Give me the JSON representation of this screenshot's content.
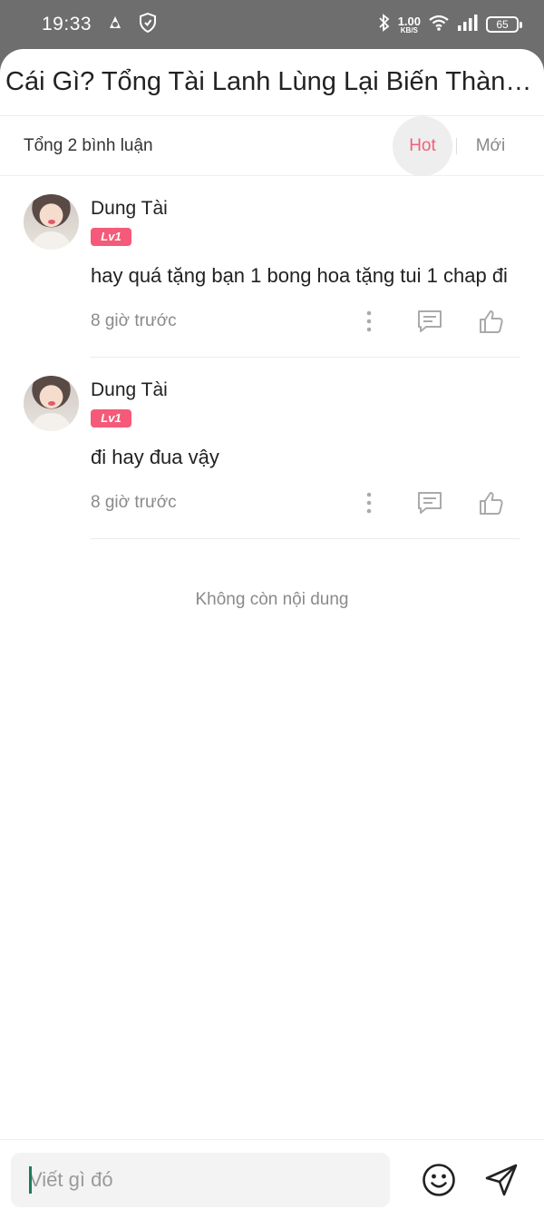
{
  "status": {
    "time": "19:33",
    "net_speed_value": "1.00",
    "net_speed_unit": "KB/S",
    "battery": "65"
  },
  "header": {
    "title": "Cái Gì? Tổng Tài Lanh Lùng Lại Biến Thành ..."
  },
  "filter": {
    "total": "Tổng 2 bình luận",
    "hot_label": "Hot",
    "new_label": "Mới",
    "active": "Hot",
    "active_color": "#f0607c"
  },
  "comments": [
    {
      "author": "Dung Tài",
      "level": "Lv1",
      "text": "hay quá tặng bạn 1 bong hoa tặng tui 1 chap đi",
      "time": "8 giờ trước"
    },
    {
      "author": "Dung Tài",
      "level": "Lv1",
      "text": "đi hay đua vậy",
      "time": "8 giờ trước"
    }
  ],
  "end_message": "Không còn nội dung",
  "composer": {
    "placeholder": "Viết gì đó"
  },
  "icons": [
    "bluetooth-icon",
    "wifi-icon",
    "signal-icon",
    "battery-icon",
    "more-icon",
    "reply-icon",
    "like-icon",
    "emoji-icon",
    "send-icon"
  ]
}
